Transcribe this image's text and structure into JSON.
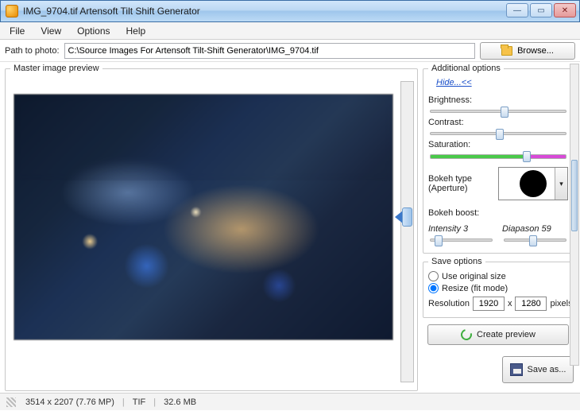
{
  "window": {
    "title": "IMG_9704.tif Artensoft Tilt Shift Generator"
  },
  "menu": {
    "file": "File",
    "view": "View",
    "options": "Options",
    "help": "Help"
  },
  "path": {
    "label": "Path to photo:",
    "value": "C:\\Source Images For Artensoft Tilt-Shift Generator\\IMG_9704.tif",
    "browse": "Browse..."
  },
  "preview": {
    "legend": "Master image preview"
  },
  "options": {
    "legend": "Additional options",
    "hide": "Hide...<<",
    "brightness": "Brightness:",
    "contrast": "Contrast:",
    "saturation": "Saturation:",
    "bokeh_type_label": "Bokeh type (Aperture)",
    "bokeh_boost": "Bokeh boost:",
    "intensity_label": "Intensity 3",
    "diapason_label": "Diapason 59"
  },
  "save": {
    "legend": "Save options",
    "use_original": "Use original size",
    "resize": "Resize (fit mode)",
    "resolution_label": "Resolution",
    "width": "1920",
    "height": "1280",
    "x": "x",
    "px": "pixels"
  },
  "buttons": {
    "create_preview": "Create preview",
    "save_as": "Save as..."
  },
  "status": {
    "dims": "3514 x 2207 (7.76 MP)",
    "fmt": "TIF",
    "size": "32.6 MB"
  }
}
